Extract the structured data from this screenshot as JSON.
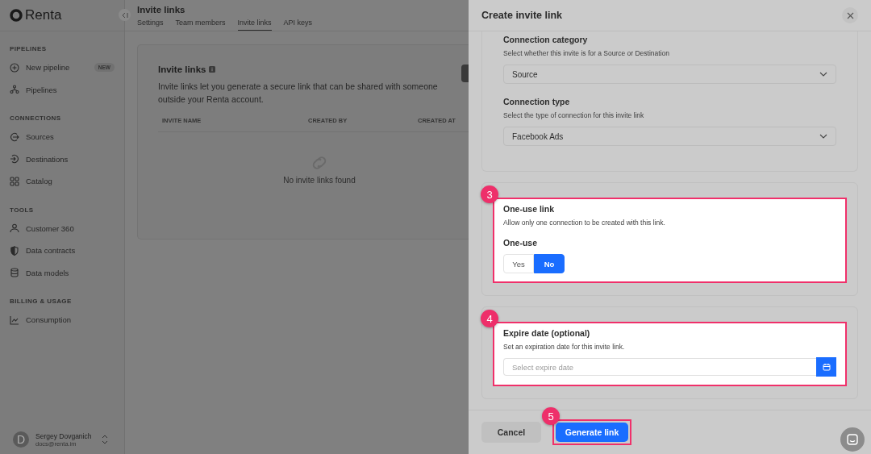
{
  "sidebar": {
    "logo": "Renta",
    "sections": [
      {
        "title": "PIPELINES",
        "items": [
          {
            "label": "New pipeline",
            "badge": "NEW"
          },
          {
            "label": "Pipelines"
          }
        ]
      },
      {
        "title": "CONNECTIONS",
        "items": [
          {
            "label": "Sources"
          },
          {
            "label": "Destinations"
          },
          {
            "label": "Catalog"
          }
        ]
      },
      {
        "title": "TOOLS",
        "items": [
          {
            "label": "Customer 360"
          },
          {
            "label": "Data contracts"
          },
          {
            "label": "Data models"
          }
        ]
      },
      {
        "title": "BILLING & USAGE",
        "items": [
          {
            "label": "Consumption"
          }
        ]
      }
    ],
    "user": {
      "initial": "D",
      "name": "Sergey Dovganich",
      "email": "docs@renta.im"
    }
  },
  "header": {
    "title": "Invite links",
    "tabs": [
      {
        "label": "Settings",
        "selected": false
      },
      {
        "label": "Team members",
        "selected": false
      },
      {
        "label": "Invite links",
        "selected": true
      },
      {
        "label": "API keys",
        "selected": false
      }
    ]
  },
  "card": {
    "title": "Invite links",
    "description": "Invite links let you generate a secure link that can be shared with someone outside your Renta account.",
    "columns": [
      "INVITE NAME",
      "CREATED BY",
      "CREATED AT"
    ],
    "empty": "No invite links found"
  },
  "drawer": {
    "title": "Create invite link",
    "sections": [
      {
        "kind": "selects",
        "highlighted": false,
        "fields": [
          {
            "label": "Connection category",
            "description": "Select whether this invite is for a Source or Destination",
            "value": "Source"
          },
          {
            "label": "Connection type",
            "description": "Select the type of connection for this invite link",
            "value": "Facebook Ads"
          }
        ]
      },
      {
        "kind": "toggle",
        "highlighted": true,
        "step": "3",
        "title": "One-use link",
        "description": "Allow only one connection to be created with this link.",
        "field_label": "One-use",
        "options": [
          {
            "label": "Yes",
            "selected": false
          },
          {
            "label": "No",
            "selected": true
          }
        ]
      },
      {
        "kind": "date",
        "highlighted": true,
        "step": "4",
        "title": "Expire date (optional)",
        "description": "Set an expiration date for this invite link.",
        "placeholder": "Select expire date"
      }
    ],
    "footer": {
      "cancel": "Cancel",
      "generate": "Generate link",
      "step": "5",
      "highlighted": true
    }
  }
}
